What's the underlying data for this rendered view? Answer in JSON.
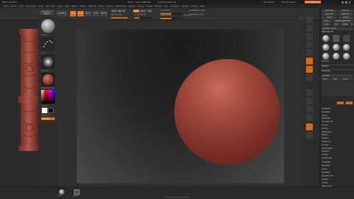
{
  "titlebar": {
    "app_title": "ZBrush 2018.1",
    "center_info": "Wiz 2 · 16:9 | 180/LSM",
    "center_info2": "Camera [S0/1+1]",
    "quicksave": "QuickSave",
    "seethrough": "See-through 0",
    "default_script": "DefaultZScript"
  },
  "menu": [
    "Alpha",
    "Brush",
    "Color",
    "Document",
    "Draw",
    "Edit",
    "File",
    "Layer",
    "Light",
    "Macro",
    "Marker",
    "Material",
    "Movie",
    "Picture",
    "Preferences",
    "Render",
    "Stencil",
    "Stroke",
    "Texture",
    "Tool",
    "Transform",
    "Zplugin",
    "Zscript",
    "Help"
  ],
  "toolbar": {
    "projection_master": "Projection Master",
    "lightbox": "LightBox",
    "edit": "Edit",
    "draw": "Draw",
    "move": "Move",
    "scale": "Scale",
    "rotate": "Rotate",
    "mrgb": "Mrgb",
    "rgb": "Rgb",
    "m": "M",
    "zadd": "Zadd",
    "zsub": "Zsub",
    "zcut": "Zcut",
    "rgb_intensity": "Rgb Intensity",
    "z_intensity": "Z Intensity 25",
    "focal_shift": "Focal Shift 0",
    "draw_size": "Draw Size 64",
    "dynamic": "Dynamic",
    "active_points": "ActivePoints: 2,004",
    "total_points": "TotalPoints: 2,004",
    "rgb_intensity_level": 1.0,
    "z_intensity_level": 0.25,
    "draw_size_level": 0.5,
    "focal_shift_level": 0.5
  },
  "left_shelf": {
    "brush_label": "Standard",
    "stroke_label": "Dots",
    "alpha_label": "Alpha Off",
    "texture_label": "Texture Off",
    "material_label": "MatCap Red Wax",
    "gradient_label": "Gradient",
    "switch_color": "SwitchColor",
    "alternate": "Alternate"
  },
  "right_tray": {
    "header_load": "Load Tool",
    "header_save": "Save As",
    "copy_tool": "Copy Tool",
    "paste_tool": "Paste Tool",
    "import": "Import",
    "export": "Export",
    "clone": "Clone",
    "make_polymesh": "Make PolyMesh3D",
    "goz": "GoZ",
    "all": "All",
    "visible": "Visible",
    "r": "R",
    "lightbox_tools": "Lightbox ▸ Tools",
    "sphere3d": "Sphere3D",
    "tool_name": "Sphere3D 48",
    "subtool": "Subtool",
    "geometry": "Geometry",
    "initialize": "Initialize",
    "x_res": "X Res",
    "y_res": "Y Res",
    "z_res": "Z Res",
    "items": [
      "ArrayMesh",
      "NanoMesh",
      "Layers",
      "FiberMesh",
      "Geometry HD",
      "Preview",
      "Surface",
      "Deformation",
      "Masking",
      "Visibility",
      "Polygroups",
      "Contact",
      "Morph Target",
      "Polypaint",
      "UV Map",
      "Texture Map",
      "Displacement Map",
      "Normal Map",
      "Vector Displacement Map",
      "Display Properties",
      "Unified Skin",
      "Initialize",
      "Import",
      "Export"
    ],
    "bottom_items": [
      "ArrayMesh",
      "NanoMesh",
      "Layers",
      "FiberMesh",
      "Geometry HD",
      "Preview",
      "Surface",
      "Deformation",
      "Masking",
      "Visibility"
    ]
  },
  "bottom": {
    "floor_label": "Floor",
    "frame_label": "Frame"
  },
  "colors": {
    "accent": "#d46a14",
    "background": "#2b2b2b",
    "sphere": "#a24a3e"
  }
}
